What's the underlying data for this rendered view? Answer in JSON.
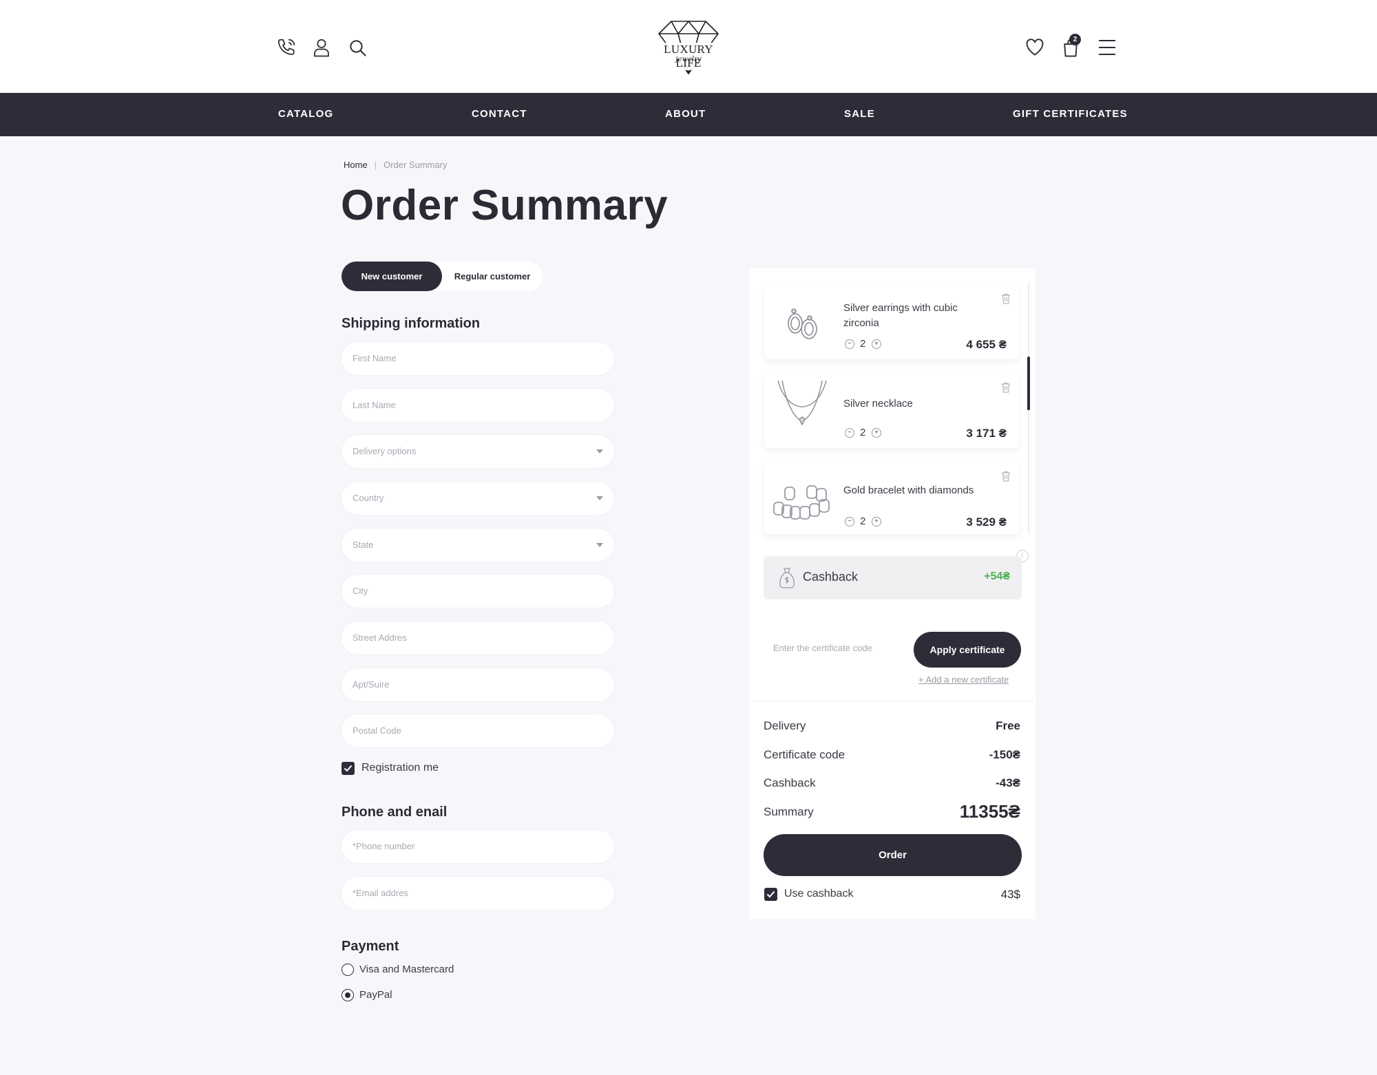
{
  "header": {
    "logo_text": "LUXURY LIFE",
    "logo_sub": "jewelry",
    "cart_count": "2"
  },
  "nav": {
    "items": [
      "CATALOG",
      "CONTACT",
      "ABOUT",
      "SALE",
      "GIFT CERTIFICATES"
    ]
  },
  "breadcrumb": {
    "home": "Home",
    "separator": "|",
    "current": "Order Summary"
  },
  "page_title": "Order Summary",
  "customer_tabs": {
    "active": "New customer",
    "inactive": "Regular customer"
  },
  "shipping": {
    "title": "Shipping information",
    "fields": {
      "first_name": "First Name",
      "last_name": "Last Name",
      "delivery": "Delivery options",
      "country": "Country",
      "state": "State",
      "city": "City",
      "street": "Street Addres",
      "apt": "Apt/Suire",
      "postal": "Postal Code"
    },
    "registration_label": "Registration me",
    "registration_checked": true
  },
  "contact": {
    "title": "Phone and enail",
    "phone_placeholder": "*Phone number",
    "email_placeholder": "*Email addres"
  },
  "payment": {
    "title": "Payment",
    "options": [
      "Visa and Mastercard",
      "PayPal"
    ],
    "selected": "PayPal"
  },
  "cart": {
    "items": [
      {
        "name": "Silver earrings with cubic zirconia",
        "qty": "2",
        "price": "4 655 ₴",
        "icon": "earrings-icon"
      },
      {
        "name": "Silver necklace",
        "qty": "2",
        "price": "3 171 ₴",
        "icon": "necklace-icon"
      },
      {
        "name": "Gold bracelet with diamonds",
        "qty": "2",
        "price": "3 529 ₴",
        "icon": "bracelet-icon"
      }
    ],
    "minus": "−",
    "plus": "+"
  },
  "cashback_box": {
    "label": "Cashback",
    "value": "+54₴",
    "value_color": "#4caf50"
  },
  "certificate": {
    "placeholder": "Enter the certificate code",
    "apply_label": "Apply certificate",
    "add_new": "+ Add a new certificate"
  },
  "summary": {
    "delivery_label": "Delivery",
    "delivery_value": "Free",
    "certificate_label": "Certificate code",
    "certificate_value": "-150₴",
    "cashback_label": "Cashback",
    "cashback_value": "-43₴",
    "summary_label": "Summary",
    "summary_value": "11355₴"
  },
  "order_button": "Order",
  "use_cashback": {
    "label": "Use cashback",
    "value": "43$",
    "checked": true
  },
  "colors": {
    "accent": "#2d2d3a",
    "background": "#f7f7fb",
    "cashback_green": "#4caf50"
  }
}
